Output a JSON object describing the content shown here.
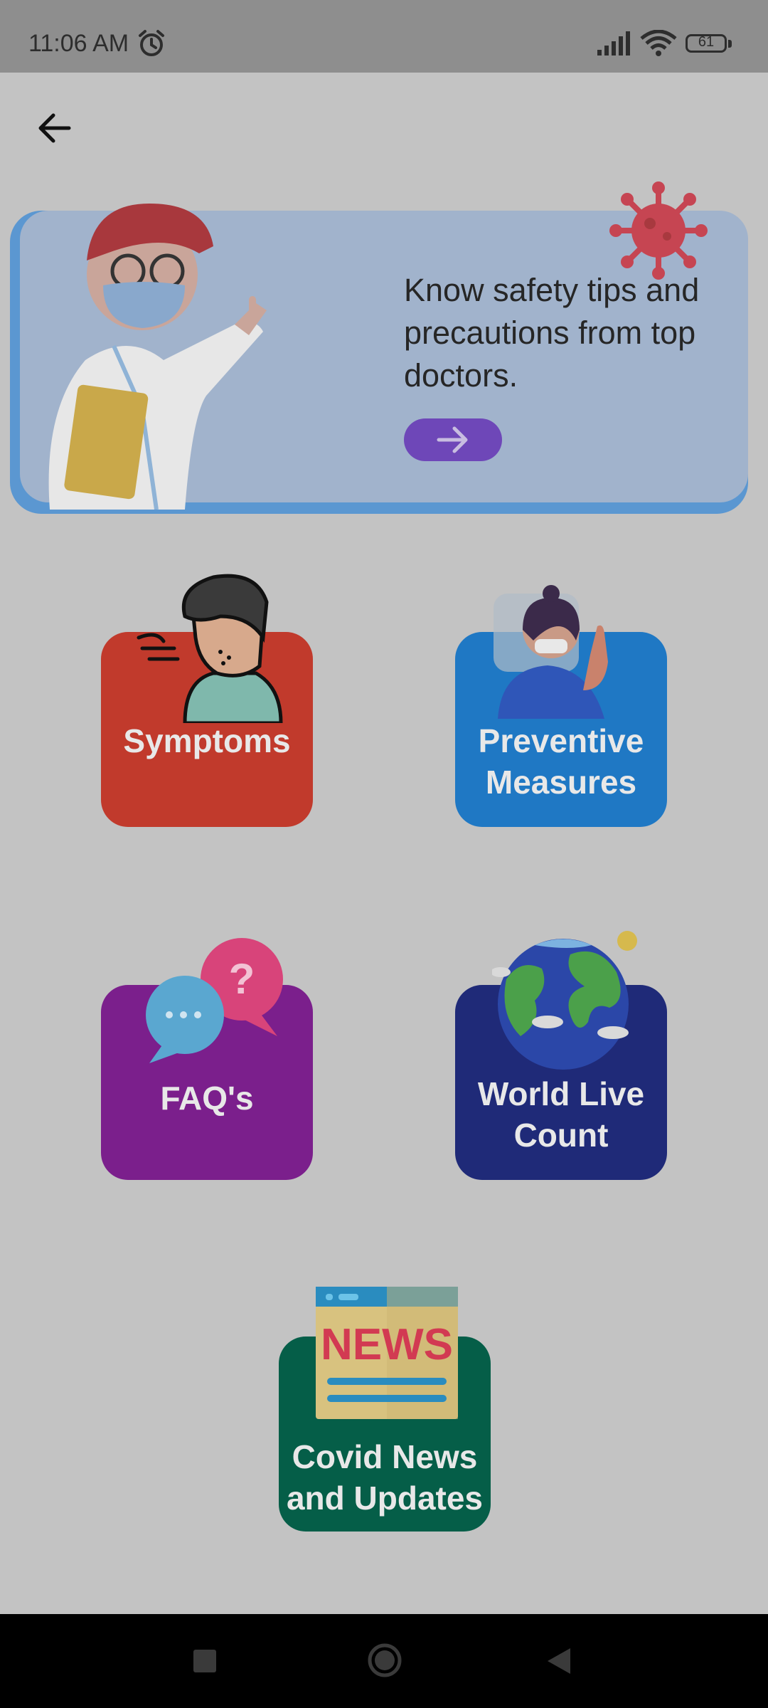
{
  "status_bar": {
    "time": "11:06 AM",
    "battery": "61",
    "icons": [
      "alarm-icon",
      "signal-icon",
      "wifi-icon",
      "battery-icon"
    ]
  },
  "toolbar": {
    "back_icon": "arrow-left-icon"
  },
  "banner": {
    "text": "Know safety tips and precautions from top doctors.",
    "button_icon": "arrow-right-icon",
    "colors": {
      "card": "#a1b3cc",
      "edge": "#5b97d1",
      "button": "#6e47b8"
    }
  },
  "tiles": [
    {
      "id": "symptoms",
      "label": "Symptoms",
      "icon": "coughing-person-icon",
      "color": "#c13a2c"
    },
    {
      "id": "preventive",
      "label": "Preventive Measures",
      "icon": "masked-woman-icon",
      "color": "#1f78c4"
    },
    {
      "id": "faqs",
      "label": "FAQ's",
      "icon": "chat-bubbles-icon",
      "color": "#7b1f8c"
    },
    {
      "id": "world",
      "label": "World Live Count",
      "icon": "globe-icon",
      "color": "#1f2a78"
    },
    {
      "id": "news",
      "label": "Covid News and Updates",
      "icon": "newspaper-icon",
      "news_art_text": "NEWS",
      "color": "#055e48"
    }
  ],
  "nav_bar": {
    "buttons": [
      "recents-button",
      "home-button",
      "back-button"
    ]
  }
}
